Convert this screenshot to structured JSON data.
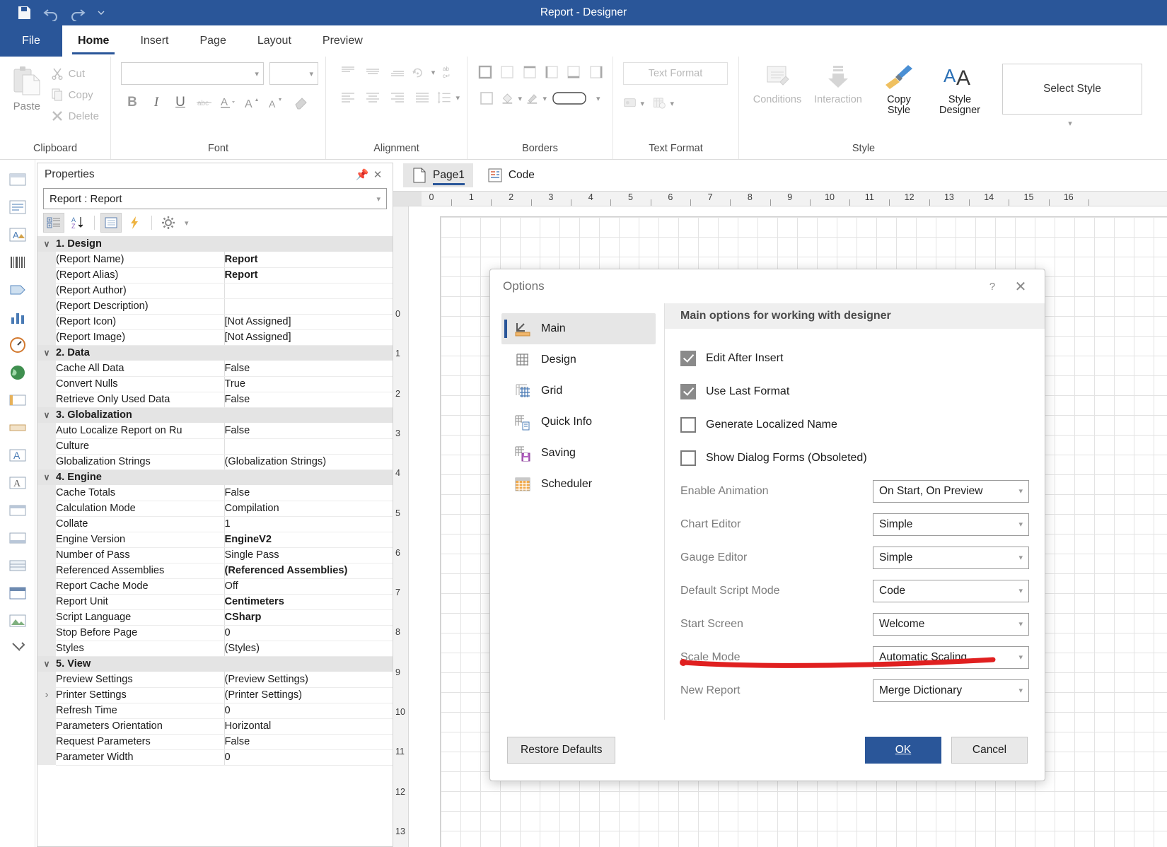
{
  "titlebar": {
    "title": "Report - Designer",
    "quick_access": [
      {
        "name": "save-icon",
        "label": "Save"
      },
      {
        "name": "undo-icon",
        "label": "Undo"
      },
      {
        "name": "redo-icon",
        "label": "Redo"
      },
      {
        "name": "customize-qat-icon",
        "label": "Customize Quick Access Toolbar"
      }
    ]
  },
  "ribbon": {
    "file_tab": "File",
    "tabs": [
      {
        "label": "Home",
        "active": true
      },
      {
        "label": "Insert",
        "active": false
      },
      {
        "label": "Page",
        "active": false
      },
      {
        "label": "Layout",
        "active": false
      },
      {
        "label": "Preview",
        "active": false
      }
    ],
    "groups": {
      "clipboard": {
        "label": "Clipboard",
        "paste": "Paste",
        "cut": "Cut",
        "copy": "Copy",
        "delete": "Delete"
      },
      "font": {
        "label": "Font",
        "family_value": "",
        "size_value": "",
        "buttons": [
          "B",
          "I",
          "U",
          "abc",
          "A",
          "A",
          "A",
          "eraser"
        ]
      },
      "alignment": {
        "label": "Alignment"
      },
      "borders": {
        "label": "Borders"
      },
      "text_format": {
        "label": "Text Format",
        "combo_value": "Text Format"
      },
      "style": {
        "label": "Style",
        "conditions": "Conditions",
        "interaction": "Interaction",
        "copy_style_l1": "Copy",
        "copy_style_l2": "Style",
        "style_designer_l1": "Style",
        "style_designer_l2": "Designer",
        "select_style": "Select Style"
      }
    }
  },
  "properties_panel": {
    "title": "Properties",
    "object_selector": "Report : Report",
    "rows": [
      {
        "type": "category",
        "name": "1. Design"
      },
      {
        "type": "prop",
        "name": "(Report Name)",
        "value": "Report",
        "bold": true
      },
      {
        "type": "prop",
        "name": "(Report Alias)",
        "value": "Report",
        "bold": true
      },
      {
        "type": "prop",
        "name": "(Report Author)",
        "value": ""
      },
      {
        "type": "prop",
        "name": "(Report Description)",
        "value": ""
      },
      {
        "type": "prop",
        "name": "(Report Icon)",
        "value": "[Not Assigned]"
      },
      {
        "type": "prop",
        "name": "(Report Image)",
        "value": "[Not Assigned]"
      },
      {
        "type": "category",
        "name": "2. Data"
      },
      {
        "type": "prop",
        "name": "Cache All Data",
        "value": "False"
      },
      {
        "type": "prop",
        "name": "Convert Nulls",
        "value": "True"
      },
      {
        "type": "prop",
        "name": "Retrieve Only Used Data",
        "value": "False"
      },
      {
        "type": "category",
        "name": "3. Globalization"
      },
      {
        "type": "prop",
        "name": "Auto Localize Report on Ru",
        "value": "False"
      },
      {
        "type": "prop",
        "name": "Culture",
        "value": ""
      },
      {
        "type": "prop",
        "name": "Globalization Strings",
        "value": "(Globalization Strings)"
      },
      {
        "type": "category",
        "name": "4. Engine"
      },
      {
        "type": "prop",
        "name": "Cache Totals",
        "value": "False"
      },
      {
        "type": "prop",
        "name": "Calculation Mode",
        "value": "Compilation"
      },
      {
        "type": "prop",
        "name": "Collate",
        "value": "1"
      },
      {
        "type": "prop",
        "name": "Engine Version",
        "value": "EngineV2",
        "bold": true
      },
      {
        "type": "prop",
        "name": "Number of Pass",
        "value": "Single Pass"
      },
      {
        "type": "prop",
        "name": "Referenced Assemblies",
        "value": "(Referenced Assemblies)",
        "bold": true
      },
      {
        "type": "prop",
        "name": "Report Cache Mode",
        "value": "Off"
      },
      {
        "type": "prop",
        "name": "Report Unit",
        "value": "Centimeters",
        "bold": true
      },
      {
        "type": "prop",
        "name": "Script Language",
        "value": "CSharp",
        "bold": true
      },
      {
        "type": "prop",
        "name": "Stop Before Page",
        "value": "0"
      },
      {
        "type": "prop",
        "name": "Styles",
        "value": "(Styles)"
      },
      {
        "type": "category",
        "name": "5. View"
      },
      {
        "type": "prop",
        "name": "Preview Settings",
        "value": "(Preview Settings)"
      },
      {
        "type": "prop",
        "name": "Printer Settings",
        "value": "(Printer Settings)",
        "expandable": true
      },
      {
        "type": "prop",
        "name": "Refresh Time",
        "value": "0"
      },
      {
        "type": "prop",
        "name": "Parameters Orientation",
        "value": "Horizontal"
      },
      {
        "type": "prop",
        "name": "Request Parameters",
        "value": "False"
      },
      {
        "type": "prop",
        "name": "Parameter Width",
        "value": "0"
      }
    ]
  },
  "designer": {
    "tabs": [
      {
        "label": "Page1",
        "icon": "page-icon",
        "active": true
      },
      {
        "label": "Code",
        "icon": "code-icon",
        "active": false
      }
    ],
    "ruler_h_labels": [
      "0",
      "1",
      "2",
      "3",
      "4",
      "5",
      "6",
      "7",
      "8",
      "9",
      "10",
      "11",
      "12",
      "13",
      "14",
      "15",
      "16"
    ],
    "ruler_v_labels": [
      "0",
      "1",
      "2",
      "3",
      "4",
      "5",
      "6",
      "7",
      "8",
      "9",
      "10",
      "11",
      "12",
      "13"
    ]
  },
  "dialog": {
    "title": "Options",
    "help_label": "?",
    "close_label": "✕",
    "nav": [
      {
        "label": "Main",
        "icon": "main-ruler-icon",
        "active": true
      },
      {
        "label": "Design",
        "icon": "design-grid-icon",
        "active": false
      },
      {
        "label": "Grid",
        "icon": "grid-icon",
        "active": false
      },
      {
        "label": "Quick Info",
        "icon": "quick-info-icon",
        "active": false
      },
      {
        "label": "Saving",
        "icon": "saving-icon",
        "active": false
      },
      {
        "label": "Scheduler",
        "icon": "scheduler-icon",
        "active": false
      }
    ],
    "section_header": "Main options for working with designer",
    "checkboxes": [
      {
        "label": "Edit After Insert",
        "checked": true
      },
      {
        "label": "Use Last Format",
        "checked": true
      },
      {
        "label": "Generate Localized Name",
        "checked": false
      },
      {
        "label": "Show Dialog Forms (Obsoleted)",
        "checked": false
      }
    ],
    "fields": [
      {
        "label": "Enable Animation",
        "value": "On Start, On Preview"
      },
      {
        "label": "Chart Editor",
        "value": "Simple"
      },
      {
        "label": "Gauge Editor",
        "value": "Simple"
      },
      {
        "label": "Default Script Mode",
        "value": "Code"
      },
      {
        "label": "Start Screen",
        "value": "Welcome"
      },
      {
        "label": "Scale Mode",
        "value": "Automatic Scaling"
      },
      {
        "label": "New Report",
        "value": "Merge Dictionary"
      }
    ],
    "buttons": {
      "restore": "Restore Defaults",
      "ok": "OK",
      "cancel": "Cancel"
    }
  },
  "annotation": {
    "color": "#e02020",
    "target": "Scale Mode"
  },
  "colors": {
    "accent": "#2a5699",
    "titlebar": "#2a5699",
    "annotation_red": "#e02020"
  }
}
